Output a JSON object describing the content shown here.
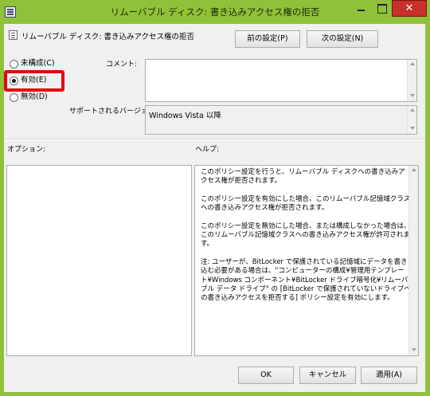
{
  "window": {
    "title": "リムーバブル ディスク: 書き込みアクセス権の拒否",
    "close_label": "✕"
  },
  "header": {
    "title": "リムーバブル ディスク: 書き込みアクセス権の拒否",
    "prev_button": "前の設定(P)",
    "next_button": "次の設定(N)"
  },
  "state": {
    "options": [
      {
        "label": "未構成(C)",
        "checked": false
      },
      {
        "label": "有効(E)",
        "checked": true
      },
      {
        "label": "無効(D)",
        "checked": false
      }
    ],
    "highlight_color": "#e30613"
  },
  "comment": {
    "label": "コメント:",
    "value": ""
  },
  "supported": {
    "label": "サポートされるバージョン:",
    "value": "Windows Vista 以降"
  },
  "options_panel": {
    "label": "オプション:"
  },
  "help_panel": {
    "label": "ヘルプ:",
    "paragraphs": [
      "このポリシー設定を行うと、リムーバブル ディスクへの書き込みアクセス権が拒否されます。",
      "このポリシー設定を有効にした場合、このリムーバブル記憶域クラスへの書き込みアクセス権が拒否されます。",
      "このポリシー設定を無効にした場合、または構成しなかった場合は、このリムーバブル記憶域クラスへの書き込みアクセス権が許可されます。",
      "注: ユーザーが、BitLocker で保護されている記憶域にデータを書き込む必要がある場合は、\"コンピューターの構成¥管理用テンプレート¥Windows コンポーネント¥BitLocker ドライブ暗号化¥リムーバブル データ ドライブ\" の [BitLocker で保護されていないドライブへの書き込みアクセスを拒否する] ポリシー設定を有効にします。"
    ]
  },
  "footer": {
    "ok": "OK",
    "cancel": "キャンセル",
    "apply": "適用(A)"
  },
  "colors": {
    "titlebar": "#8fc238",
    "close_button": "#c7302b"
  }
}
